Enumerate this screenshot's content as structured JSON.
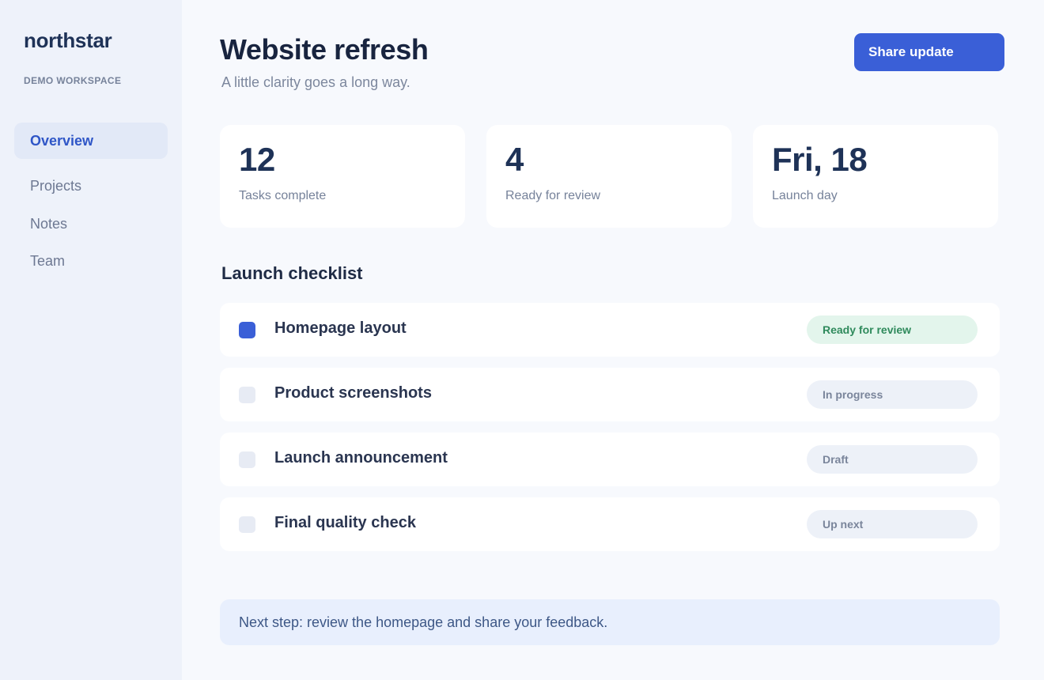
{
  "sidebar": {
    "brand": "northstar",
    "workspace": "DEMO WORKSPACE",
    "nav": [
      {
        "label": "Overview",
        "active": true
      },
      {
        "label": "Projects",
        "active": false
      },
      {
        "label": "Notes",
        "active": false
      },
      {
        "label": "Team",
        "active": false
      }
    ]
  },
  "header": {
    "title": "Website refresh",
    "subtitle": "A little clarity goes a long way.",
    "share_label": "Share update"
  },
  "stats": [
    {
      "value": "12",
      "label": "Tasks complete"
    },
    {
      "value": "4",
      "label": "Ready for review"
    },
    {
      "value": "Fri, 18",
      "label": "Launch day"
    }
  ],
  "checklist": {
    "title": "Launch checklist",
    "items": [
      {
        "label": "Homepage layout",
        "checked": true,
        "status": "Ready for review"
      },
      {
        "label": "Product screenshots",
        "checked": false,
        "status": "In progress"
      },
      {
        "label": "Launch announcement",
        "checked": false,
        "status": "Draft"
      },
      {
        "label": "Final quality check",
        "checked": false,
        "status": "Up next"
      }
    ]
  },
  "next_step": "Next step: review the homepage and share your feedback.",
  "colors": {
    "accent": "#3a5fd7",
    "sidebar_bg": "#eef2fa",
    "page_bg": "#f7f9fd",
    "ready_status": "#2f8a5c"
  }
}
